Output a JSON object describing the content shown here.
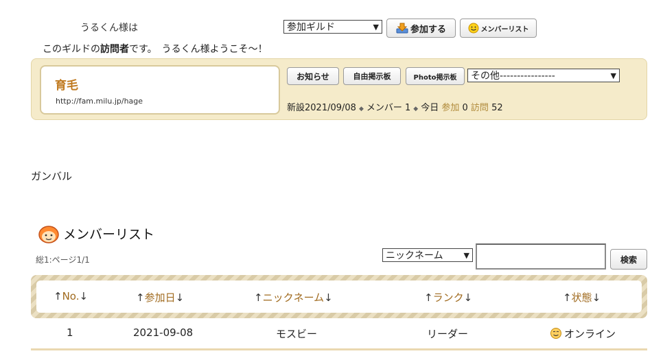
{
  "greeting": {
    "line1": "うるくん様は",
    "line2_prefix": "このギルドの",
    "line2_bold": "訪問者",
    "line2_suffix": "です。　うるくん様ようこそ～！"
  },
  "top_controls": {
    "guild_select": "参加ギルド",
    "join_button": "参加する",
    "member_list_button": "メンバーリスト"
  },
  "guild": {
    "name": "育毛",
    "url": "http://fam.milu.jp/hage",
    "nav": {
      "notice": "お知らせ",
      "free_board": "自由掲示板",
      "photo_board": "Photo掲示板",
      "other_select": "その他----------------"
    },
    "stats": {
      "created": "新設2021/09/08",
      "members": "メンバー 1",
      "today": "今日",
      "join_label": "参加",
      "join_count": "0",
      "visit_label": "訪問",
      "visit_count": "52"
    }
  },
  "message": "ガンバル",
  "member_list": {
    "title": "メンバーリスト",
    "total": "総1:ページ1/1",
    "search_select": "ニックネーム",
    "search_input_value": "",
    "search_button": "検索",
    "columns": [
      "No.",
      "参加日",
      "ニックネーム",
      "ランク",
      "状態"
    ],
    "rows": [
      {
        "no": "1",
        "joined": "2021-09-08",
        "nickname": "モスビー",
        "rank": "リーダー",
        "status": "オンライン"
      }
    ]
  },
  "icons": {
    "join": "download-arrow-icon",
    "member_list": "smiley-icon",
    "title": "face-icon",
    "status": "online-smiley-icon"
  },
  "colors": {
    "accent": "#c07a20",
    "guild_box_bg": "#f5ebca",
    "header_band": "#d9cba7"
  }
}
